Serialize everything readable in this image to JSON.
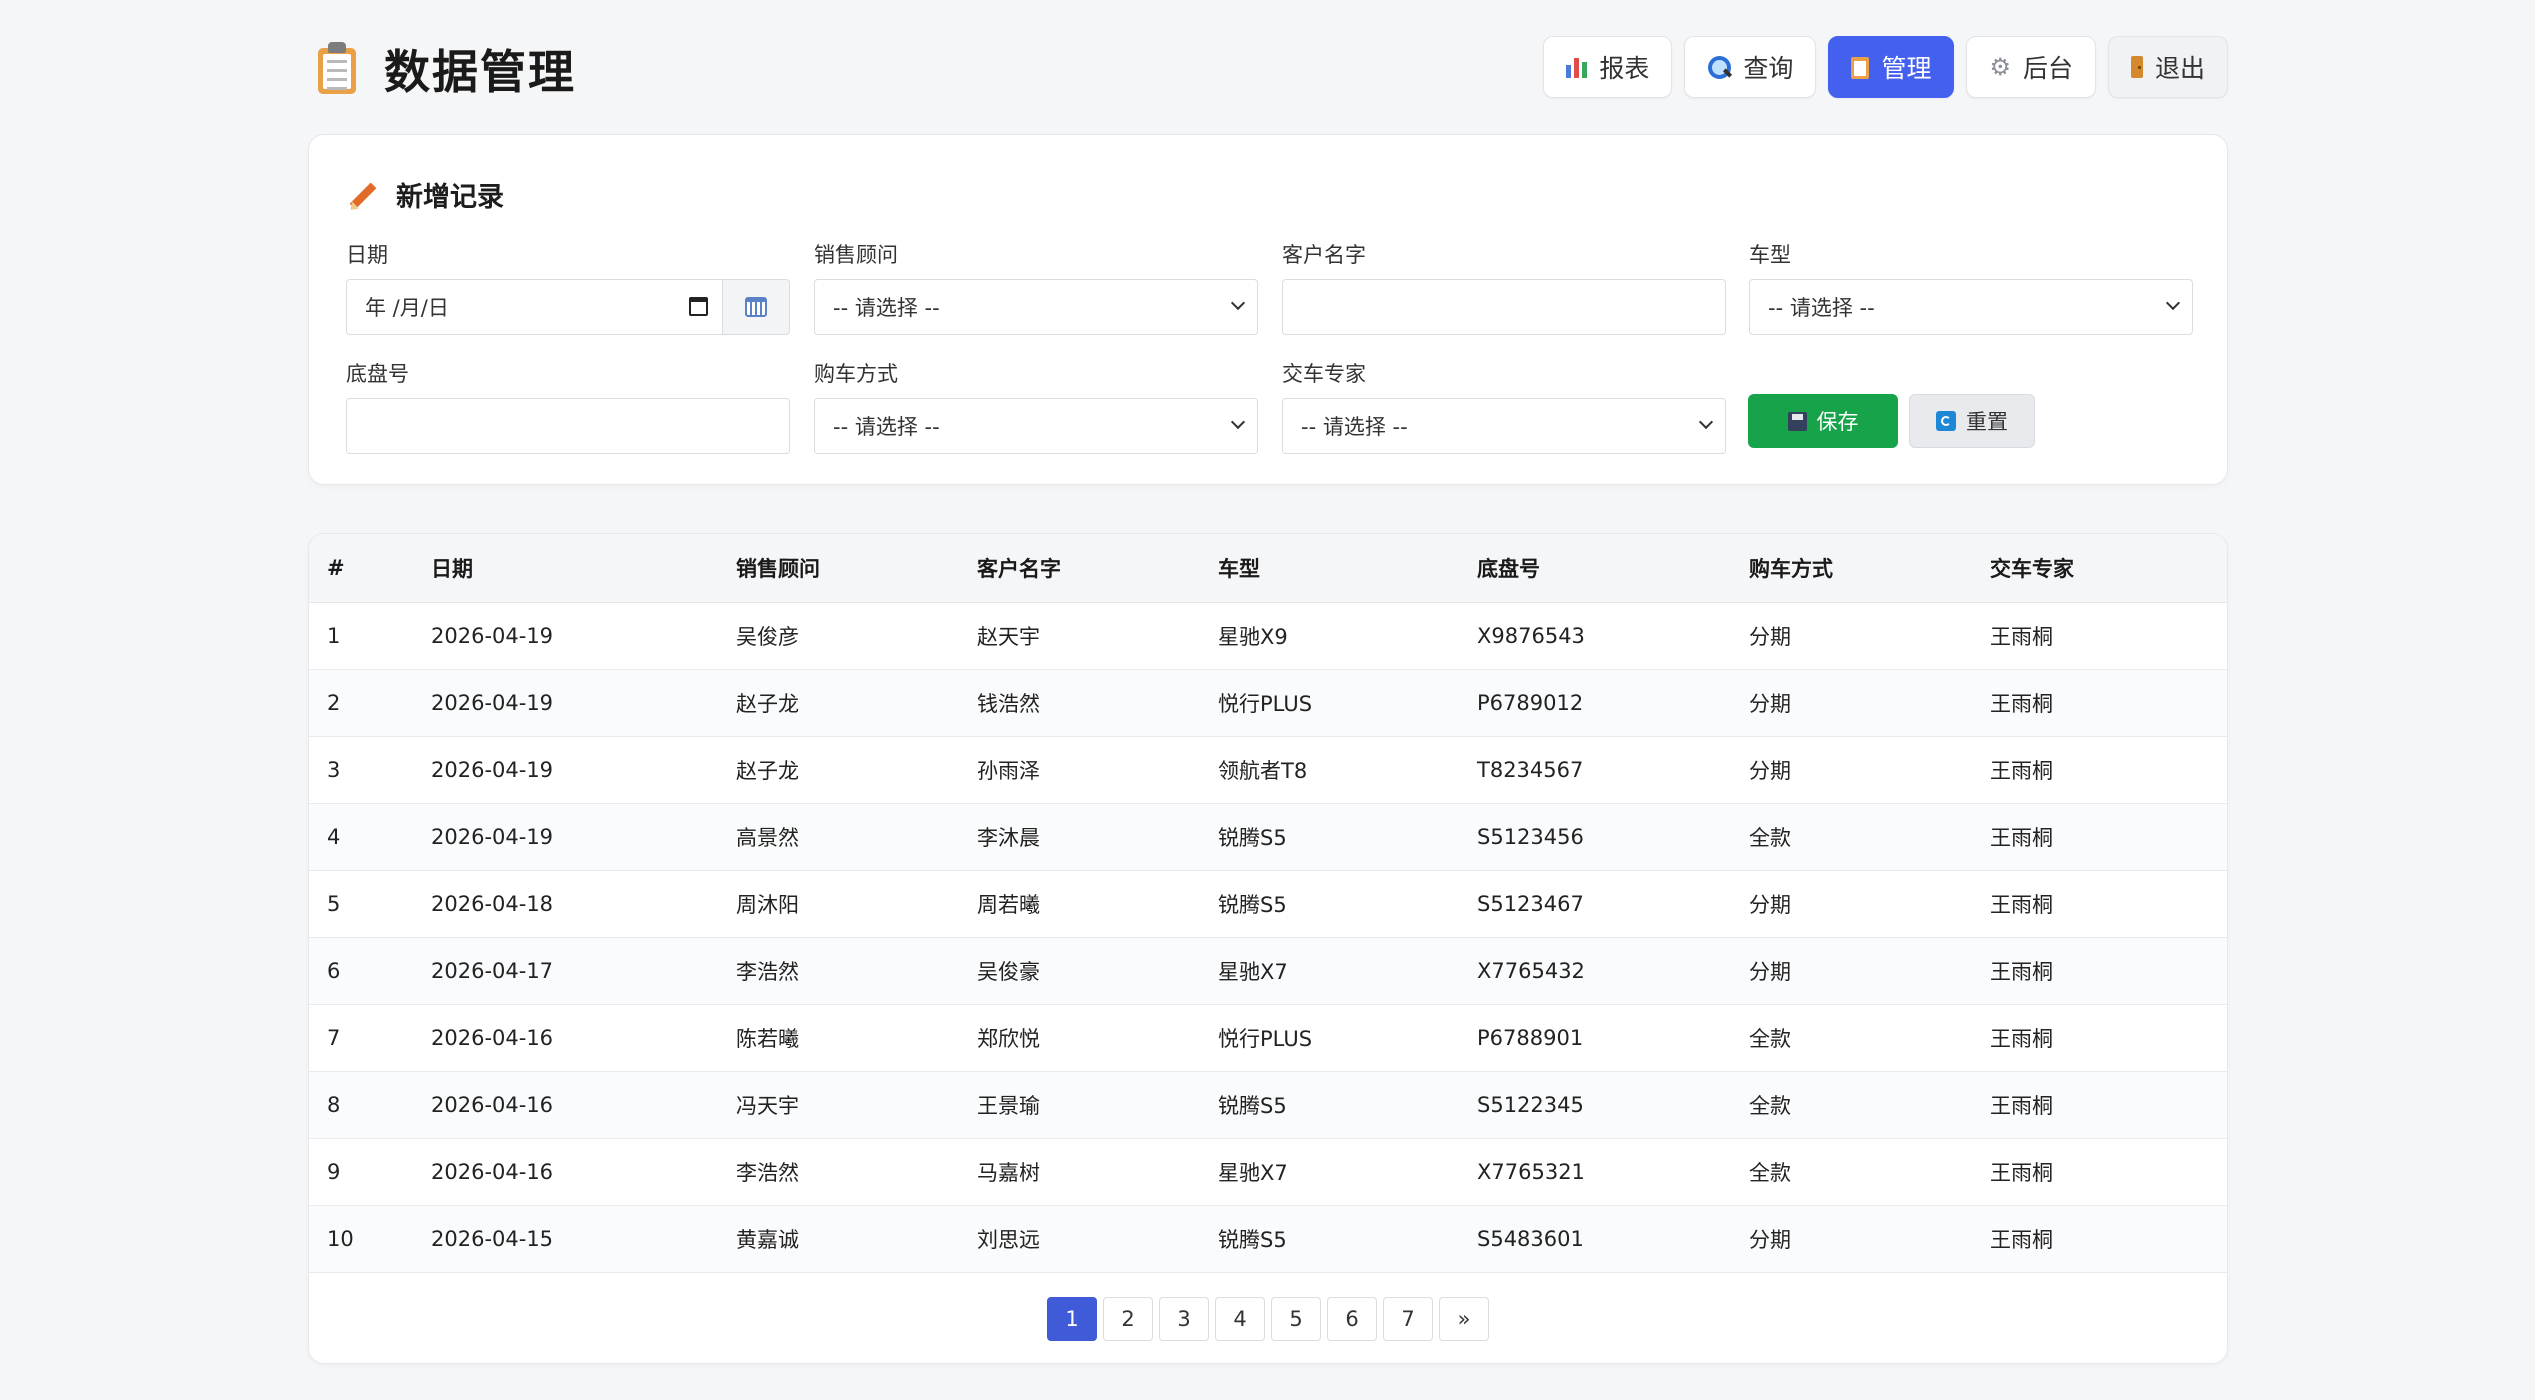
{
  "app": {
    "title": "数据管理"
  },
  "nav": [
    {
      "label": "报表",
      "icon": "bar-chart-icon"
    },
    {
      "label": "查询",
      "icon": "search-icon"
    },
    {
      "label": "管理",
      "icon": "clipboard-icon",
      "active": true
    },
    {
      "label": "后台",
      "icon": "gear-icon"
    },
    {
      "label": "退出",
      "icon": "door-icon"
    }
  ],
  "form": {
    "title": "新增记录",
    "date": {
      "label": "日期",
      "placeholder": "年 /月/日"
    },
    "advisor": {
      "label": "销售顾问",
      "value": "-- 请选择 --"
    },
    "customer": {
      "label": "客户名字",
      "value": ""
    },
    "model": {
      "label": "车型",
      "value": "-- 请选择 --"
    },
    "vin": {
      "label": "底盘号",
      "value": ""
    },
    "payment": {
      "label": "购车方式",
      "value": "-- 请选择 --"
    },
    "expert": {
      "label": "交车专家",
      "value": "-- 请选择 --"
    },
    "save_label": "保存",
    "reset_label": "重置"
  },
  "table": {
    "columns": [
      "#",
      "日期",
      "销售顾问",
      "客户名字",
      "车型",
      "底盘号",
      "购车方式",
      "交车专家"
    ],
    "rows": [
      [
        "1",
        "2026-04-19",
        "吴俊彦",
        "赵天宇",
        "星驰X9",
        "X9876543",
        "分期",
        "王雨桐"
      ],
      [
        "2",
        "2026-04-19",
        "赵子龙",
        "钱浩然",
        "悦行PLUS",
        "P6789012",
        "分期",
        "王雨桐"
      ],
      [
        "3",
        "2026-04-19",
        "赵子龙",
        "孙雨泽",
        "领航者T8",
        "T8234567",
        "分期",
        "王雨桐"
      ],
      [
        "4",
        "2026-04-19",
        "高景然",
        "李沐晨",
        "锐腾S5",
        "S5123456",
        "全款",
        "王雨桐"
      ],
      [
        "5",
        "2026-04-18",
        "周沐阳",
        "周若曦",
        "锐腾S5",
        "S5123467",
        "分期",
        "王雨桐"
      ],
      [
        "6",
        "2026-04-17",
        "李浩然",
        "吴俊豪",
        "星驰X7",
        "X7765432",
        "分期",
        "王雨桐"
      ],
      [
        "7",
        "2026-04-16",
        "陈若曦",
        "郑欣悦",
        "悦行PLUS",
        "P6788901",
        "全款",
        "王雨桐"
      ],
      [
        "8",
        "2026-04-16",
        "冯天宇",
        "王景瑜",
        "锐腾S5",
        "S5122345",
        "全款",
        "王雨桐"
      ],
      [
        "9",
        "2026-04-16",
        "李浩然",
        "马嘉树",
        "星驰X7",
        "X7765321",
        "全款",
        "王雨桐"
      ],
      [
        "10",
        "2026-04-15",
        "黄嘉诚",
        "刘思远",
        "锐腾S5",
        "S5483601",
        "分期",
        "王雨桐"
      ]
    ]
  },
  "pagination": {
    "pages": [
      "1",
      "2",
      "3",
      "4",
      "5",
      "6",
      "7"
    ],
    "current": "1",
    "next_label": "»"
  },
  "colors": {
    "primary": "#4361ee",
    "save": "#16a34a",
    "background": "#f5f6f8"
  }
}
